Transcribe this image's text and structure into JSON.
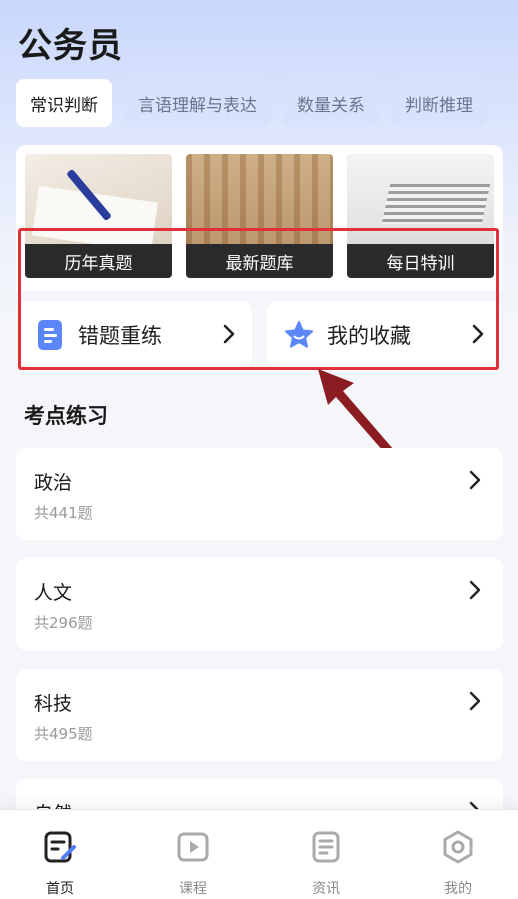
{
  "header": {
    "title": "公务员"
  },
  "tabs": [
    {
      "label": "常识判断",
      "active": true
    },
    {
      "label": "言语理解与表达",
      "active": false
    },
    {
      "label": "数量关系",
      "active": false
    },
    {
      "label": "判断推理",
      "active": false
    }
  ],
  "features": [
    {
      "label": "历年真题"
    },
    {
      "label": "最新题库"
    },
    {
      "label": "每日特训"
    }
  ],
  "quick_actions": [
    {
      "label": "错题重练",
      "icon": "document-icon"
    },
    {
      "label": "我的收藏",
      "icon": "star-icon"
    }
  ],
  "section": {
    "title": "考点练习"
  },
  "topics": [
    {
      "name": "政治",
      "count": "共441题"
    },
    {
      "name": "人文",
      "count": "共296题"
    },
    {
      "name": "科技",
      "count": "共495题"
    },
    {
      "name": "自然",
      "count": ""
    }
  ],
  "bottom_nav": [
    {
      "label": "首页",
      "icon": "edit-note-icon",
      "active": true
    },
    {
      "label": "课程",
      "icon": "video-play-icon",
      "active": false
    },
    {
      "label": "资讯",
      "icon": "news-icon",
      "active": false
    },
    {
      "label": "我的",
      "icon": "gear-icon",
      "active": false
    }
  ],
  "colors": {
    "accent": "#4e7cf6",
    "highlight": "#e0313b",
    "arrow": "#8b1d22"
  }
}
